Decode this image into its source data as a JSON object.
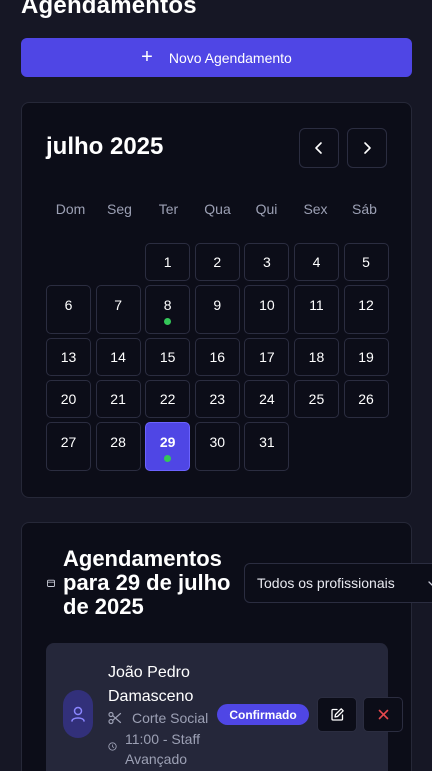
{
  "page": {
    "title": "Agendamentos"
  },
  "new_button": {
    "label": "Novo Agendamento",
    "icon": "plus-icon"
  },
  "calendar": {
    "month_label": "julho 2025",
    "weekdays": [
      "Dom",
      "Seg",
      "Ter",
      "Qua",
      "Qui",
      "Sex",
      "Sáb"
    ],
    "days": [
      "1",
      "2",
      "3",
      "4",
      "5",
      "6",
      "7",
      "8",
      "9",
      "10",
      "11",
      "12",
      "13",
      "14",
      "15",
      "16",
      "17",
      "18",
      "19",
      "20",
      "21",
      "22",
      "23",
      "24",
      "25",
      "26",
      "27",
      "28",
      "29",
      "30",
      "31"
    ],
    "days_with_appointments": [
      "8",
      "29"
    ],
    "selected_day": "29",
    "accent_color": "#4f46e5",
    "dot_color": "#34c759"
  },
  "appointments": {
    "heading": "Agendamentos para 29 de julho de 2025",
    "filter": {
      "selected": "Todos os profissionais"
    },
    "items": [
      {
        "client": "João Pedro Damasceno",
        "service": "Corte Social",
        "time": "11:00 - Staff Avançado",
        "status": "Confirmado"
      }
    ]
  }
}
